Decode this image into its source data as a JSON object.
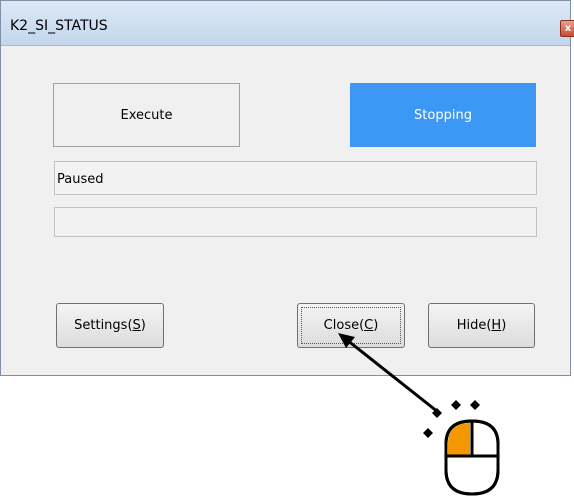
{
  "window": {
    "title": "K2_SI_STATUS",
    "close_glyph": "x"
  },
  "buttons": {
    "execute": "Execute",
    "stopping": "Stopping",
    "settings_prefix": "Settings(",
    "settings_key": "S",
    "close_prefix": "Close(",
    "close_key": "C",
    "hide_prefix": "Hide(",
    "hide_key": "H",
    "suffix": ")"
  },
  "status": {
    "text": "Paused",
    "progress": ""
  },
  "colors": {
    "stopping_bg": "#3d98f5",
    "mouse_button": "#f39800"
  },
  "icons": {
    "cursor": "mouse-click-icon",
    "arrow": "pointer-arrow"
  }
}
